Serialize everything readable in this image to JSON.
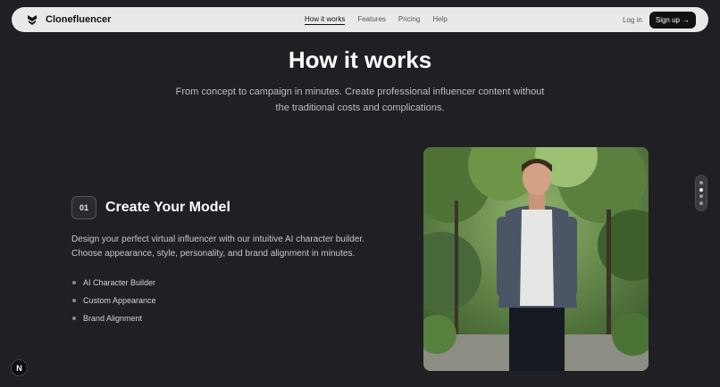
{
  "nav": {
    "brand": "Clonefluencer",
    "links": [
      {
        "label": "How it works",
        "active": true
      },
      {
        "label": "Features",
        "active": false
      },
      {
        "label": "Pricing",
        "active": false
      },
      {
        "label": "Help",
        "active": false
      }
    ],
    "login": "Log in",
    "signup": "Sign up",
    "signup_arrow": "→"
  },
  "hero": {
    "title": "How it works",
    "subtitle": "From concept to campaign in minutes. Create professional influencer content without the traditional costs and complications."
  },
  "step": {
    "number": "01",
    "title": "Create Your Model",
    "description": "Design your perfect virtual influencer with our intuitive AI character builder. Choose appearance, style, personality, and brand alignment in minutes.",
    "features": [
      "AI Character Builder",
      "Custom Appearance",
      "Brand Alignment"
    ]
  },
  "badge": "N",
  "colors": {
    "background": "#1f1f24",
    "nav": "#e9e9ea",
    "accent": "#111111"
  }
}
